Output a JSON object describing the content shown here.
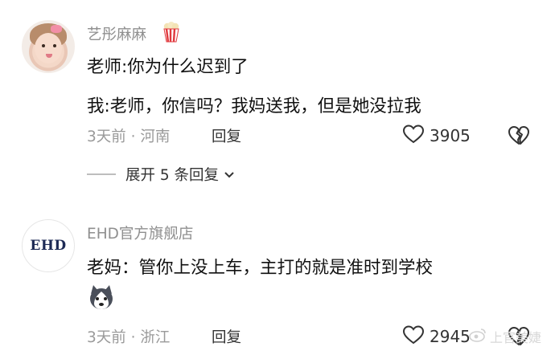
{
  "comments": [
    {
      "username": "艺彤麻麻",
      "badge_icon": "popcorn-icon",
      "lines": [
        "老师:你为什么迟到了",
        "我:老师，你信吗？我妈送我，但是她没拉我"
      ],
      "meta": "3天前 · 河南",
      "reply_label": "回复",
      "likes": "3905",
      "expand_label": "展开 5 条回复"
    },
    {
      "username": "EHD官方旗舰店",
      "avatar_text": "EHD",
      "lines": [
        "老妈：管你上没上车，主打的就是准时到学校"
      ],
      "sticker_icon": "husky-sticker-icon",
      "meta": "3天前 · 浙江",
      "reply_label": "回复",
      "likes": "2945"
    }
  ],
  "watermark": "上官美婕",
  "colors": {
    "username": "#8f8f8f",
    "meta": "#9a9a9a",
    "text": "#111111",
    "popcorn_red": "#e0393e"
  }
}
